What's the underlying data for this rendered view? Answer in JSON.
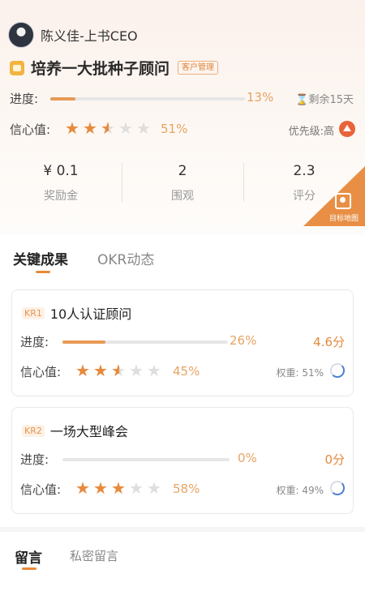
{
  "owner": {
    "name": "陈义佳-上书CEO"
  },
  "objective": {
    "title": "培养一大批种子顾问",
    "tag": "客户管理"
  },
  "progress": {
    "label": "进度:",
    "value": 13,
    "value_text": "13%",
    "remaining": "剩余15天"
  },
  "confidence": {
    "label": "信心值:",
    "stars": 2.5,
    "value_text": "51%",
    "priority": "优先级:高"
  },
  "stats": [
    {
      "value": "¥ 0.1",
      "label": "奖励金"
    },
    {
      "value": "2",
      "label": "围观"
    },
    {
      "value": "2.3",
      "label": "评分"
    }
  ],
  "map_button": {
    "label": "目标地图"
  },
  "tabs": [
    {
      "label": "关键成果"
    },
    {
      "label": "OKR动态"
    }
  ],
  "key_results": [
    {
      "badge": "KR1",
      "title": "10人认证顾问",
      "progress_label": "进度:",
      "progress": 26,
      "progress_text": "26%",
      "score": "4.6分",
      "confidence_label": "信心值:",
      "stars": 2.5,
      "confidence_text": "45%",
      "weight": "权重: 51%"
    },
    {
      "badge": "KR2",
      "title": "一场大型峰会",
      "progress_label": "进度:",
      "progress": 0,
      "progress_text": "0%",
      "score": "0分",
      "confidence_label": "信心值:",
      "stars": 3,
      "confidence_text": "58%",
      "weight": "权重: 49%"
    }
  ],
  "comment_tabs": [
    {
      "label": "留言"
    },
    {
      "label": "私密留言"
    }
  ],
  "colors": {
    "accent": "#e8893b",
    "priority_high": "#e8623a",
    "ring": "#4a7fd0"
  }
}
